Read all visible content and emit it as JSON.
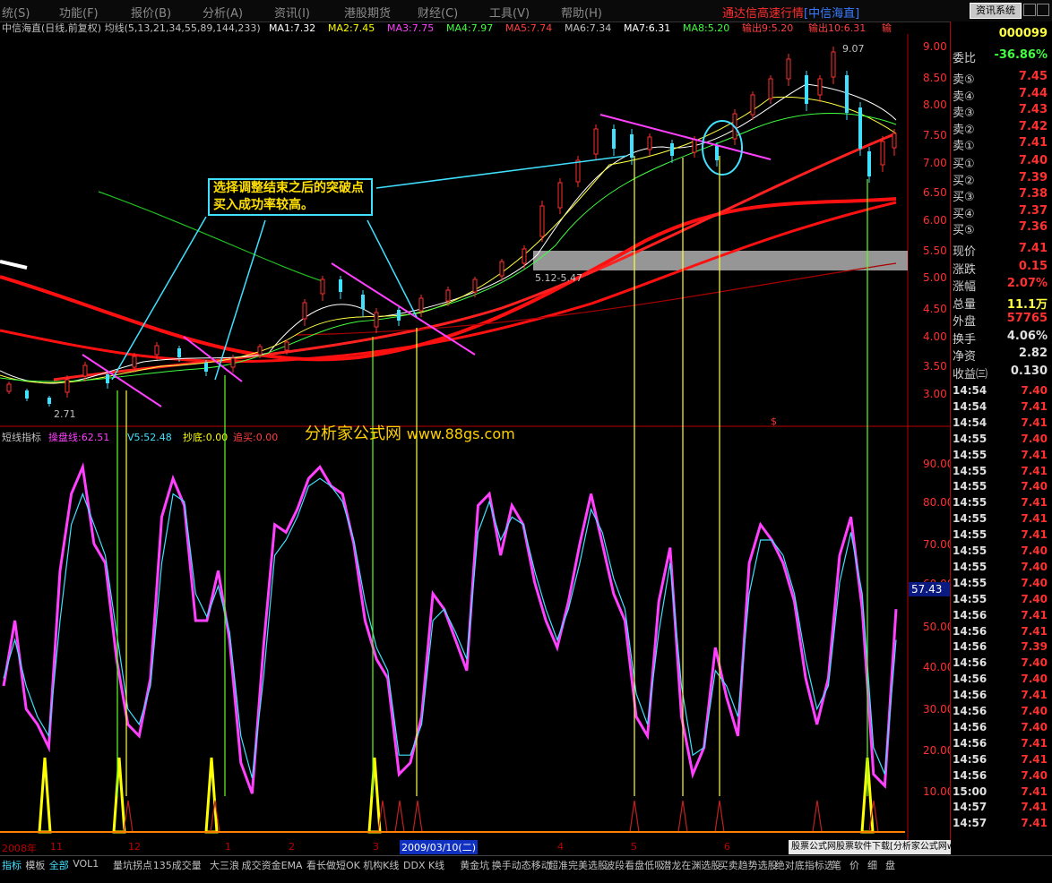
{
  "menu": {
    "items": [
      "统(S)",
      "功能(F)",
      "报价(B)",
      "分析(A)",
      "资讯(I)",
      "港股期货",
      "财经(C)",
      "工具(V)",
      "帮助(H)"
    ],
    "brand": "通达信高速行情",
    "stock_tag": "[中信海直]",
    "info_button": "资讯系统"
  },
  "main_header": {
    "title": "中信海直(日线,前复权) 均线(5,13,21,34,55,89,144,233)",
    "ma": [
      {
        "label": "MA1:7.32",
        "color": "#ffffff"
      },
      {
        "label": "MA2:7.45",
        "color": "#ffff00"
      },
      {
        "label": "MA3:7.75",
        "color": "#ff40ff"
      },
      {
        "label": "MA4:7.97",
        "color": "#40ff40"
      },
      {
        "label": "MA5:7.74",
        "color": "#ff4040"
      },
      {
        "label": "MA6:7.34",
        "color": "#c0c0c0"
      },
      {
        "label": "MA7:6.31",
        "color": "#ffffff"
      },
      {
        "label": "MA8:5.20",
        "color": "#40ff40"
      },
      {
        "label": "输出9:5.20",
        "color": "#ff4040"
      },
      {
        "label": "输出10:6.31",
        "color": "#ff4040"
      },
      {
        "label": "输",
        "color": "#ff4040"
      }
    ]
  },
  "price_axis": [
    "9.00",
    "8.50",
    "8.00",
    "7.50",
    "7.00",
    "6.50",
    "6.00",
    "5.50",
    "5.00",
    "4.50",
    "4.00",
    "3.50",
    "3.00"
  ],
  "price_annotations": {
    "high": "9.07",
    "low": "2.71",
    "gap_label": "5.12-5.47"
  },
  "annotation_text": "选择调整结束之后的突破点买入成功率较高。",
  "watermark": {
    "cn": "分析家公式网",
    "url": "www.88gs.com"
  },
  "indicator_header": {
    "title": "短线指标",
    "items": [
      {
        "label": "操盘线:62.51",
        "color": "#ff40ff"
      },
      {
        "label": "V5:52.48",
        "color": "#40e0ff"
      },
      {
        "label": "抄底:0.00",
        "color": "#ffff00"
      },
      {
        "label": "追买:0.00",
        "color": "#ff4040"
      }
    ],
    "dollar_mark": "$"
  },
  "indicator_axis": [
    "90.00",
    "80.00",
    "70.00",
    "60.00",
    "50.00",
    "40.00",
    "30.00",
    "20.00",
    "10.00"
  ],
  "indicator_current": "57.43",
  "date_axis": {
    "labels": [
      "2008年",
      "11",
      "12",
      "1",
      "2",
      "3",
      "4",
      "5",
      "6",
      "7",
      "8"
    ],
    "selected_date": "2009/03/10(二)"
  },
  "quote_panel": {
    "code": "000099",
    "weibi": {
      "label": "委比",
      "value": "-36.86%"
    },
    "sell": [
      {
        "label": "卖⑤",
        "value": "7.45"
      },
      {
        "label": "卖④",
        "value": "7.44"
      },
      {
        "label": "卖③",
        "value": "7.43"
      },
      {
        "label": "卖②",
        "value": "7.42"
      },
      {
        "label": "卖①",
        "value": "7.41"
      }
    ],
    "buy": [
      {
        "label": "买①",
        "value": "7.40"
      },
      {
        "label": "买②",
        "value": "7.39"
      },
      {
        "label": "买③",
        "value": "7.38"
      },
      {
        "label": "买④",
        "value": "7.37"
      },
      {
        "label": "买⑤",
        "value": "7.36"
      }
    ],
    "stats": [
      {
        "label": "现价",
        "value": "7.41",
        "color": "#ff3030"
      },
      {
        "label": "涨跌",
        "value": "0.15",
        "color": "#ff3030"
      },
      {
        "label": "涨幅",
        "value": "2.07%",
        "color": "#ff3030"
      },
      {
        "label": "总量",
        "value": "11.1万",
        "color": "#ffff40"
      },
      {
        "label": "外盘",
        "value": "57765",
        "color": "#ff3030"
      },
      {
        "label": "换手",
        "value": "4.06%",
        "color": "#e0e0e0"
      },
      {
        "label": "净资",
        "value": "2.82",
        "color": "#e0e0e0"
      },
      {
        "label": "收益㈢",
        "value": "0.130",
        "color": "#e0e0e0"
      }
    ],
    "ticks": [
      {
        "time": "14:54",
        "price": "7.40"
      },
      {
        "time": "14:54",
        "price": "7.41"
      },
      {
        "time": "14:54",
        "price": "7.41"
      },
      {
        "time": "14:55",
        "price": "7.40"
      },
      {
        "time": "14:55",
        "price": "7.41"
      },
      {
        "time": "14:55",
        "price": "7.41"
      },
      {
        "time": "14:55",
        "price": "7.40"
      },
      {
        "time": "14:55",
        "price": "7.41"
      },
      {
        "time": "14:55",
        "price": "7.41"
      },
      {
        "time": "14:55",
        "price": "7.41"
      },
      {
        "time": "14:55",
        "price": "7.40"
      },
      {
        "time": "14:55",
        "price": "7.40"
      },
      {
        "time": "14:55",
        "price": "7.40"
      },
      {
        "time": "14:55",
        "price": "7.40"
      },
      {
        "time": "14:56",
        "price": "7.41"
      },
      {
        "time": "14:56",
        "price": "7.41"
      },
      {
        "time": "14:56",
        "price": "7.39"
      },
      {
        "time": "14:56",
        "price": "7.40"
      },
      {
        "time": "14:56",
        "price": "7.40"
      },
      {
        "time": "14:56",
        "price": "7.41"
      },
      {
        "time": "14:56",
        "price": "7.40"
      },
      {
        "time": "14:56",
        "price": "7.40"
      },
      {
        "time": "14:56",
        "price": "7.41"
      },
      {
        "time": "14:56",
        "price": "7.41"
      },
      {
        "time": "14:56",
        "price": "7.40"
      },
      {
        "time": "15:00",
        "price": "7.41"
      },
      {
        "time": "14:57",
        "price": "7.41"
      },
      {
        "time": "14:57",
        "price": "7.41"
      }
    ]
  },
  "bottom_tabs": [
    "指标",
    "模板",
    "全部",
    "VOL1",
    "量坑拐点",
    "135成交量",
    "大三浪",
    "成交资金EMA",
    "看长做短OK",
    "机构K线",
    "DDX K线",
    "黄金坑",
    "换手动态移动",
    "超准完美选股",
    "波段看盘低吸",
    "潜龙在渊选股",
    "买卖趋势选股",
    "绝对底指标选",
    "笔",
    "价",
    "细",
    "盘"
  ],
  "ad_banner": "股票公式网股票软件下载[分析家公式网www.88gs.com]",
  "chart_data": {
    "type": "line",
    "title": "",
    "series": [
      {
        "name": "操盘线",
        "color": "#ff40ff",
        "values": [
          38,
          55,
          32,
          28,
          22,
          68,
          88,
          95,
          75,
          70,
          45,
          28,
          25,
          40,
          82,
          92,
          85,
          55,
          55,
          68,
          50,
          18,
          10,
          48,
          80,
          78,
          84,
          92,
          95,
          90,
          88,
          75,
          55,
          45,
          40,
          15,
          18,
          30,
          62,
          58,
          50,
          42,
          85,
          88,
          72,
          85,
          80,
          65,
          55,
          48,
          60,
          75,
          88,
          75,
          62,
          55,
          30,
          25,
          60,
          74,
          30,
          15,
          22,
          48,
          35,
          25,
          70,
          80,
          76,
          70,
          60,
          40,
          28,
          40,
          72,
          82,
          58,
          15,
          12,
          58
        ]
      },
      {
        "name": "V5",
        "color": "#40e0ff",
        "values": [
          40,
          50,
          38,
          30,
          25,
          55,
          80,
          88,
          80,
          72,
          52,
          32,
          28,
          38,
          70,
          88,
          86,
          62,
          56,
          64,
          52,
          25,
          14,
          40,
          72,
          76,
          82,
          90,
          92,
          90,
          86,
          76,
          60,
          48,
          42,
          20,
          20,
          28,
          55,
          58,
          52,
          45,
          78,
          86,
          76,
          82,
          80,
          68,
          58,
          50,
          58,
          70,
          84,
          78,
          66,
          58,
          36,
          28,
          52,
          70,
          38,
          20,
          22,
          42,
          38,
          30,
          62,
          76,
          76,
          72,
          62,
          45,
          32,
          38,
          65,
          78,
          62,
          22,
          15,
          50
        ]
      }
    ],
    "buy_signals_bottom_index": [
      2,
      6,
      11,
      21,
      35,
      39
    ],
    "price_ylim": [
      2.71,
      9.07
    ],
    "indicator_ylim": [
      0,
      100
    ]
  }
}
